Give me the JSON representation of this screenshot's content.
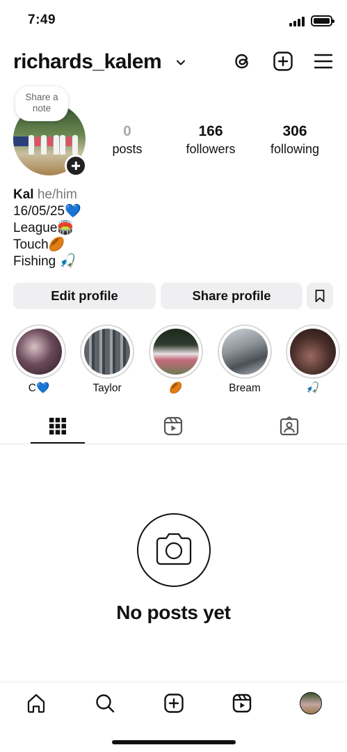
{
  "status_bar": {
    "time": "7:49"
  },
  "header": {
    "username": "richards_kalem",
    "icons": [
      "chevron-down-icon",
      "threads-icon",
      "new-post-icon",
      "menu-icon"
    ]
  },
  "profile": {
    "note_prompt": "Share a note",
    "stats": [
      {
        "value": "0",
        "label": "posts"
      },
      {
        "value": "166",
        "label": "followers"
      },
      {
        "value": "306",
        "label": "following"
      }
    ],
    "bio": {
      "name": "Kal",
      "pronouns": "he/him",
      "lines": [
        "16/05/25💙",
        "League🏟️",
        "Touch🏉",
        "Fishing 🎣"
      ]
    }
  },
  "actions": {
    "edit_label": "Edit profile",
    "share_label": "Share profile",
    "extra_icon": "bookmark-icon"
  },
  "highlights": [
    {
      "label": "C💙"
    },
    {
      "label": "Taylor"
    },
    {
      "label": "🏉"
    },
    {
      "label": "Bream"
    },
    {
      "label": "🎣"
    }
  ],
  "tabs": [
    "grid-icon",
    "reels-icon",
    "tagged-icon"
  ],
  "empty_state": {
    "title": "No posts yet"
  },
  "bottom_nav": [
    "home-icon",
    "search-icon",
    "create-icon",
    "reels-icon",
    "profile-avatar"
  ]
}
